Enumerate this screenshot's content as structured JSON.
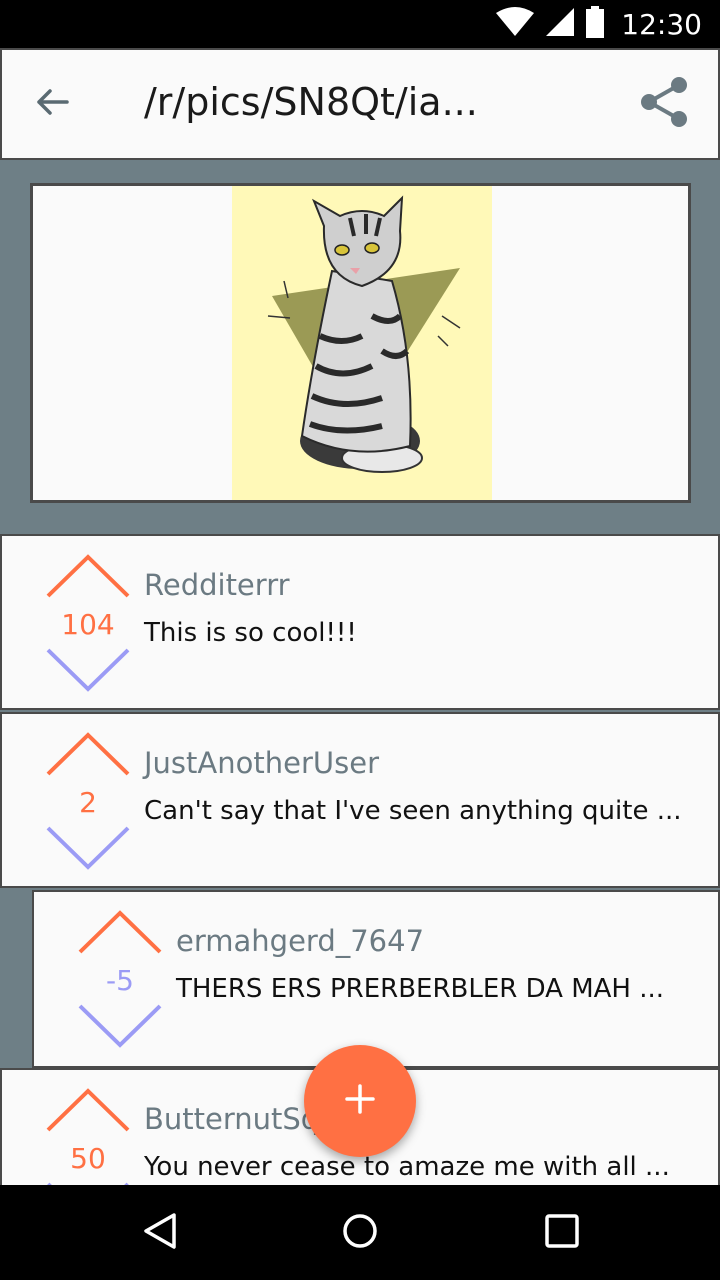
{
  "status_bar": {
    "time": "12:30",
    "icons": [
      "wifi-icon",
      "signal-icon",
      "battery-icon"
    ]
  },
  "toolbar": {
    "title": "/r/pics/SN8Qt/ia...",
    "back_icon": "arrow-left-icon",
    "share_icon": "share-icon"
  },
  "post": {
    "image_subject": "cat illustration"
  },
  "comments": [
    {
      "author": "Redditerrr",
      "score": "104",
      "text": "This is so cool!!!",
      "score_color": "#ff7043",
      "depth": 0
    },
    {
      "author": "JustAnotherUser",
      "score": "2",
      "text": "Can't say that I've seen anything quite ...",
      "score_color": "#ff7043",
      "depth": 0
    },
    {
      "author": "ermahgerd_7647",
      "score": "-5",
      "text": "THERS ERS PRERBERBLER DA MAH ...",
      "score_color": "#9b9bf5",
      "depth": 1
    },
    {
      "author": "ButternutSq",
      "score": "50",
      "text": "You never cease to amaze me with all ...",
      "score_color": "#ff7043",
      "depth": 0
    }
  ],
  "fab": {
    "icon": "plus-icon"
  },
  "nav": {
    "back": "nav-back-icon",
    "home": "nav-home-icon",
    "recents": "nav-recents-icon"
  },
  "colors": {
    "upvote": "#ff7043",
    "downvote": "#9b9bf5",
    "accent": "#ff7043",
    "background": "#6e7f86"
  }
}
